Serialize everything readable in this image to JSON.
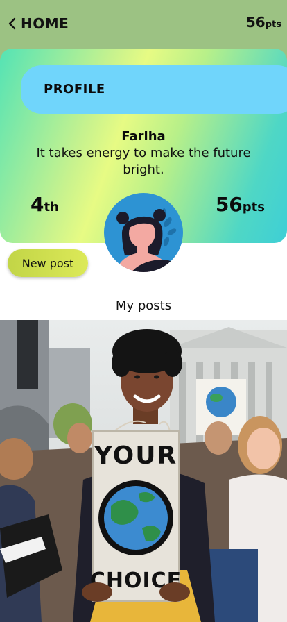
{
  "header": {
    "back_label": "HOME",
    "points_value": "56",
    "points_unit": "pts"
  },
  "profile": {
    "section_title": "PROFILE",
    "name": "Fariha",
    "quote": "It takes energy to make the future bright.",
    "rank_value": "4",
    "rank_suffix": "th",
    "points_value": "56",
    "points_unit": "pts"
  },
  "actions": {
    "new_post_label": "New post"
  },
  "posts": {
    "section_title": "My posts",
    "items": [
      {
        "sign_top": "YOUR",
        "sign_bottom": "CHOICE"
      }
    ]
  },
  "colors": {
    "topbar": "#9cc283",
    "profile_pill": "#70d5fb",
    "avatar_bg": "#2d93d3",
    "new_post_button": "#c2d547"
  }
}
